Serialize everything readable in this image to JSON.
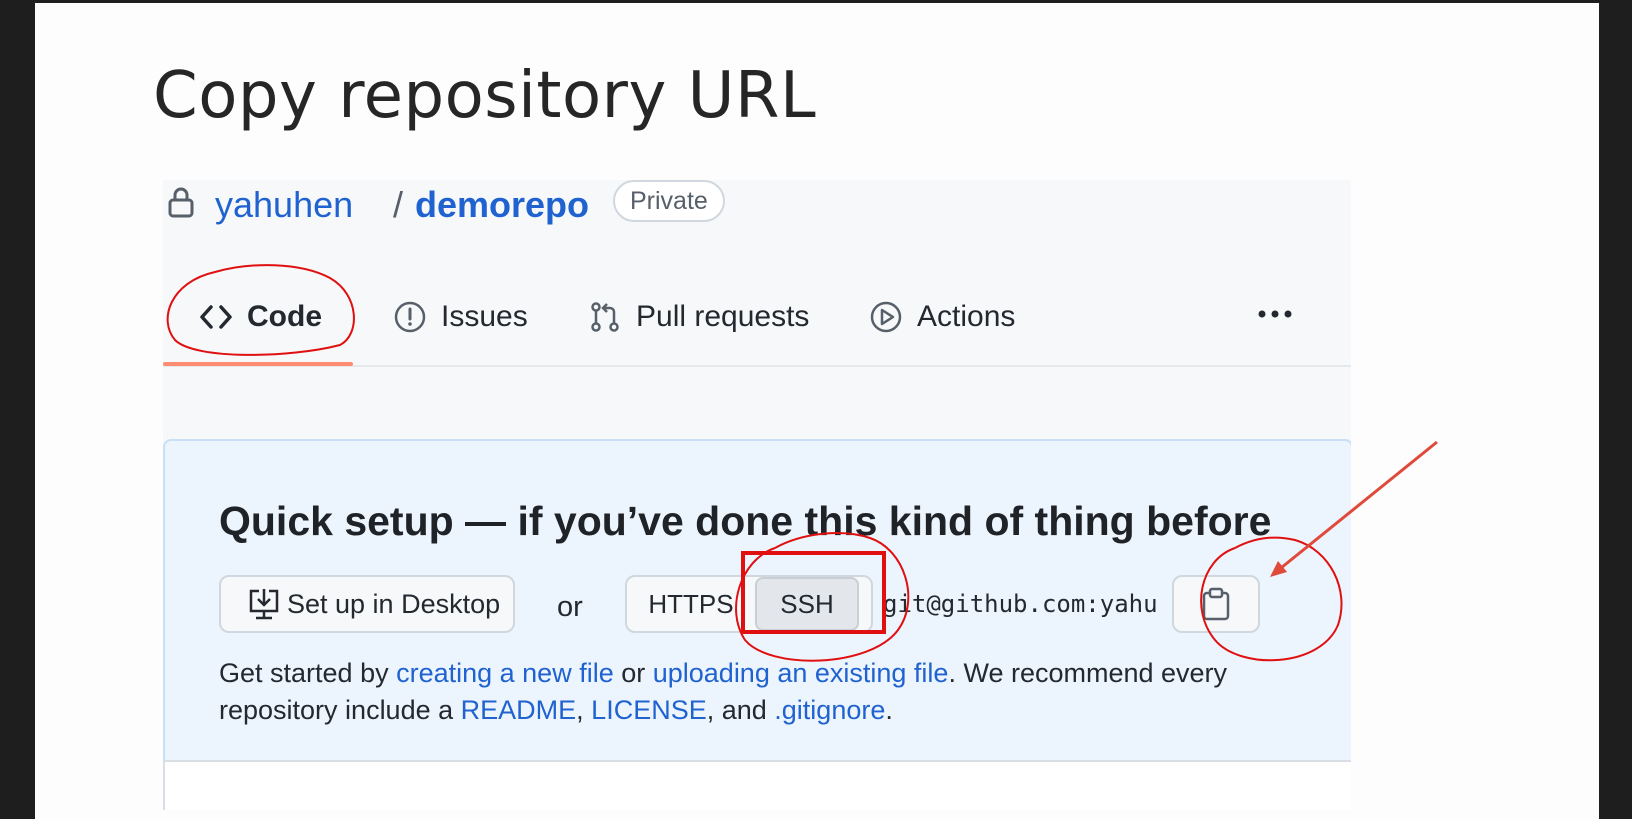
{
  "slide": {
    "title": "Copy repository URL"
  },
  "repo": {
    "owner": "yahuhen",
    "separator": "/",
    "name": "demorepo",
    "visibility_badge": "Private"
  },
  "tabs": [
    {
      "label": "Code",
      "icon": "code-icon",
      "selected": true
    },
    {
      "label": "Issues",
      "icon": "issue-icon"
    },
    {
      "label": "Pull requests",
      "icon": "pull-request-icon"
    },
    {
      "label": "Actions",
      "icon": "play-icon"
    }
  ],
  "more_menu_icon": "kebab-horizontal-icon",
  "setup": {
    "title": "Quick setup — if you’ve done this kind of thing before",
    "desktop_button": "Set up in Desktop",
    "or_text": "or",
    "protocols": [
      "HTTPS",
      "SSH"
    ],
    "selected_protocol": "SSH",
    "clone_url": "git@github.com:yahu",
    "copy_icon": "clipboard-icon",
    "desc_part1": "Get started by ",
    "link_new_file": "creating a new file",
    "desc_part2": " or ",
    "link_upload": "uploading an existing file",
    "desc_part3": ". We recommend every repository include a ",
    "link_readme": "README",
    "desc_sep1": ", ",
    "link_license": "LICENSE",
    "desc_sep2": ", and ",
    "link_gitignore": ".gitignore",
    "desc_end": "."
  },
  "colors": {
    "accent": "#1f62d0",
    "annotation": "#e01010",
    "tab_underline": "#fd8c73"
  }
}
